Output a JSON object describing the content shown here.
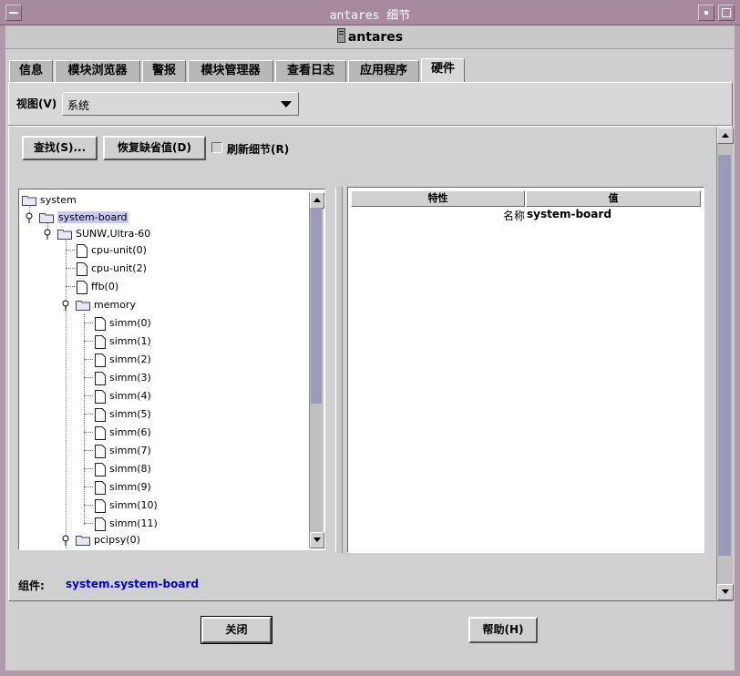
{
  "window": {
    "title": "antares 细节",
    "host": "antares"
  },
  "tabs": [
    {
      "label": "信息"
    },
    {
      "label": "模块浏览器"
    },
    {
      "label": "警报"
    },
    {
      "label": "模块管理器"
    },
    {
      "label": "查看日志"
    },
    {
      "label": "应用程序"
    },
    {
      "label": "硬件"
    }
  ],
  "view": {
    "label": "视图(V)",
    "selected": "系统"
  },
  "toolbar": {
    "find_label": "查找(S)...",
    "restore_label": "恢复缺省值(D)",
    "refresh_label": "刷新细节(R)"
  },
  "tree": [
    {
      "label": "system"
    },
    {
      "label": "system-board"
    },
    {
      "label": "SUNW,Ultra-60"
    },
    {
      "label": "cpu-unit(0)"
    },
    {
      "label": "cpu-unit(2)"
    },
    {
      "label": "ffb(0)"
    },
    {
      "label": "memory"
    },
    {
      "label": "simm(0)"
    },
    {
      "label": "simm(1)"
    },
    {
      "label": "simm(2)"
    },
    {
      "label": "simm(3)"
    },
    {
      "label": "simm(4)"
    },
    {
      "label": "simm(5)"
    },
    {
      "label": "simm(6)"
    },
    {
      "label": "simm(7)"
    },
    {
      "label": "simm(8)"
    },
    {
      "label": "simm(9)"
    },
    {
      "label": "simm(10)"
    },
    {
      "label": "simm(11)"
    },
    {
      "label": "pcipsy(0)"
    }
  ],
  "table": {
    "headers": [
      "特性",
      "值"
    ],
    "rows": [
      {
        "property": "名称",
        "value": "system-board"
      }
    ]
  },
  "component": {
    "label": "组件:",
    "value": "system.system-board"
  },
  "footer": {
    "close_label": "关闭",
    "help_label": "帮助(H)"
  },
  "colors": {
    "selection": "#c8c8f0",
    "link_blue": "#0000c8",
    "scroll_thumb": "#9b9ab8"
  }
}
